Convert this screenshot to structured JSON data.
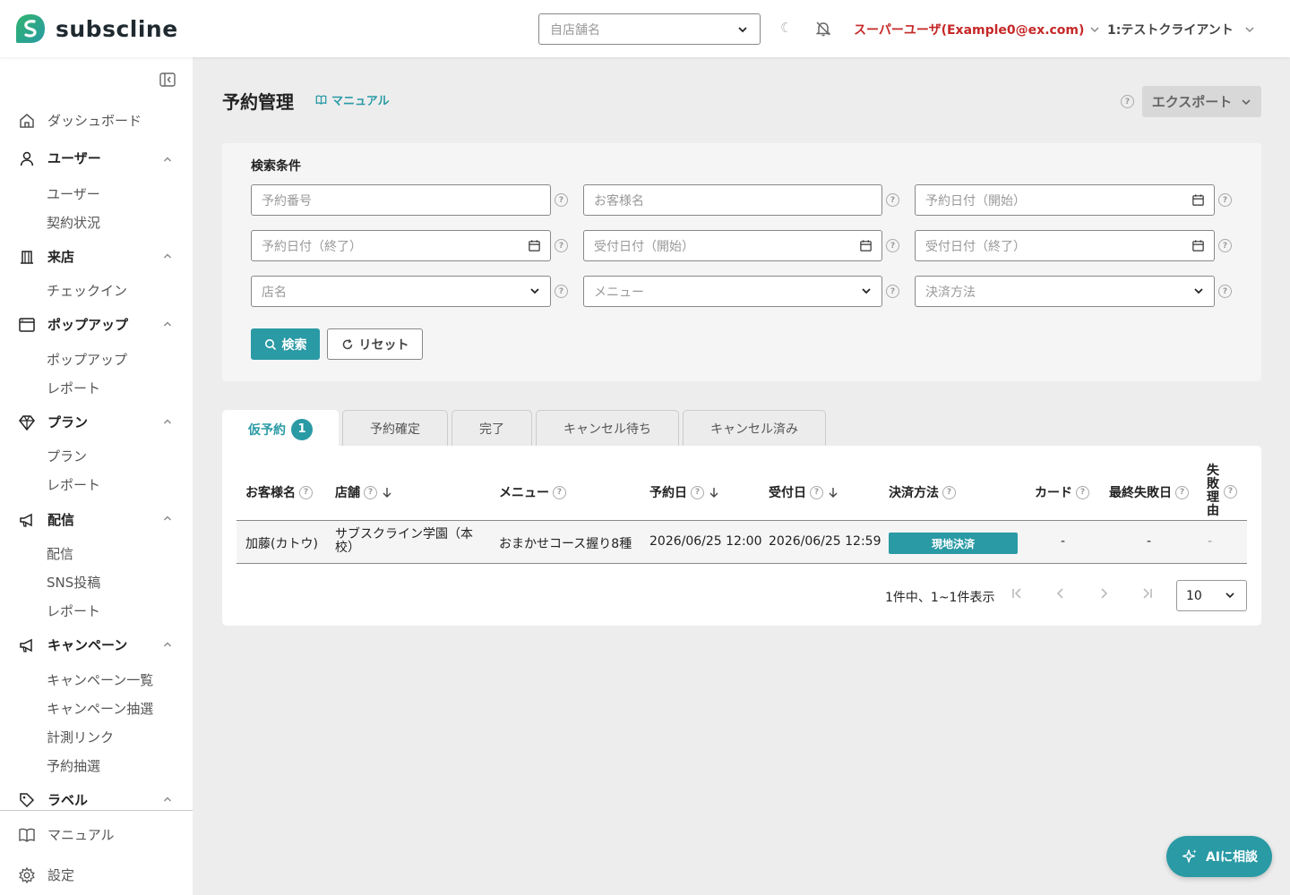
{
  "app": {
    "logo_text": "subscline"
  },
  "header": {
    "store_placeholder": "自店舗名",
    "theme_glyph": "☾",
    "user_label": "スーパーユーザ(Example0@ex.com)",
    "client_label": "1:テストクライアント"
  },
  "sidebar": {
    "dashboard": "ダッシュボード",
    "sections": [
      {
        "label": "ユーザー",
        "icon": "user-icon",
        "items": [
          "ユーザー",
          "契約状況"
        ]
      },
      {
        "label": "来店",
        "icon": "store-icon",
        "items": [
          "チェックイン"
        ]
      },
      {
        "label": "ポップアップ",
        "icon": "window-icon",
        "items": [
          "ポップアップ",
          "レポート"
        ]
      },
      {
        "label": "プラン",
        "icon": "diamond-icon",
        "items": [
          "プラン",
          "レポート"
        ]
      },
      {
        "label": "配信",
        "icon": "megaphone-icon",
        "items": [
          "配信",
          "SNS投稿",
          "レポート"
        ]
      },
      {
        "label": "キャンペーン",
        "icon": "megaphone-icon",
        "items": [
          "キャンペーン一覧",
          "キャンペーン抽選",
          "計測リンク",
          "予約抽選"
        ]
      },
      {
        "label": "ラベル",
        "icon": "tag-icon",
        "items": []
      }
    ],
    "bottom": {
      "manual": "マニュアル",
      "settings": "設定"
    }
  },
  "page": {
    "title": "予約管理",
    "manual_link": "マニュアル",
    "export_label": "エクスポート"
  },
  "search": {
    "title": "検索条件",
    "fields": {
      "reservation_number": "予約番号",
      "customer_name": "お客様名",
      "reservation_date_start": "予約日付（開始）",
      "reservation_date_end": "予約日付（終了）",
      "accepted_date_start": "受付日付（開始）",
      "accepted_date_end": "受付日付（終了）",
      "store": "店名",
      "menu": "メニュー",
      "payment_method": "決済方法"
    },
    "search_button": "検索",
    "reset_button": "リセット"
  },
  "tabs": [
    {
      "label": "仮予約",
      "badge": "1"
    },
    {
      "label": "予約確定"
    },
    {
      "label": "完了"
    },
    {
      "label": "キャンセル待ち"
    },
    {
      "label": "キャンセル済み"
    }
  ],
  "table": {
    "headers": [
      "お客様名",
      "店舗",
      "メニュー",
      "予約日",
      "受付日",
      "決済方法",
      "カード",
      "最終失敗日",
      "失敗理由"
    ],
    "rows": [
      {
        "customer": "加藤(カトウ)",
        "store": "サブスクライン学園（本校）",
        "menu": "おまかせコース握り8種",
        "reservation_date": "2026/06/25 12:00",
        "accepted_date": "2026/06/25 12:59",
        "payment": "現地決済",
        "card": "-",
        "last_failed": "-",
        "fail_reason": "-"
      }
    ]
  },
  "pagination": {
    "summary": "1件中、1~1件表示",
    "page_size": "10"
  },
  "ai_button": "AIに相談",
  "colors": {
    "accent": "#2a9aa5",
    "user_red": "#c62828",
    "logo_green": "#2fb36d"
  }
}
